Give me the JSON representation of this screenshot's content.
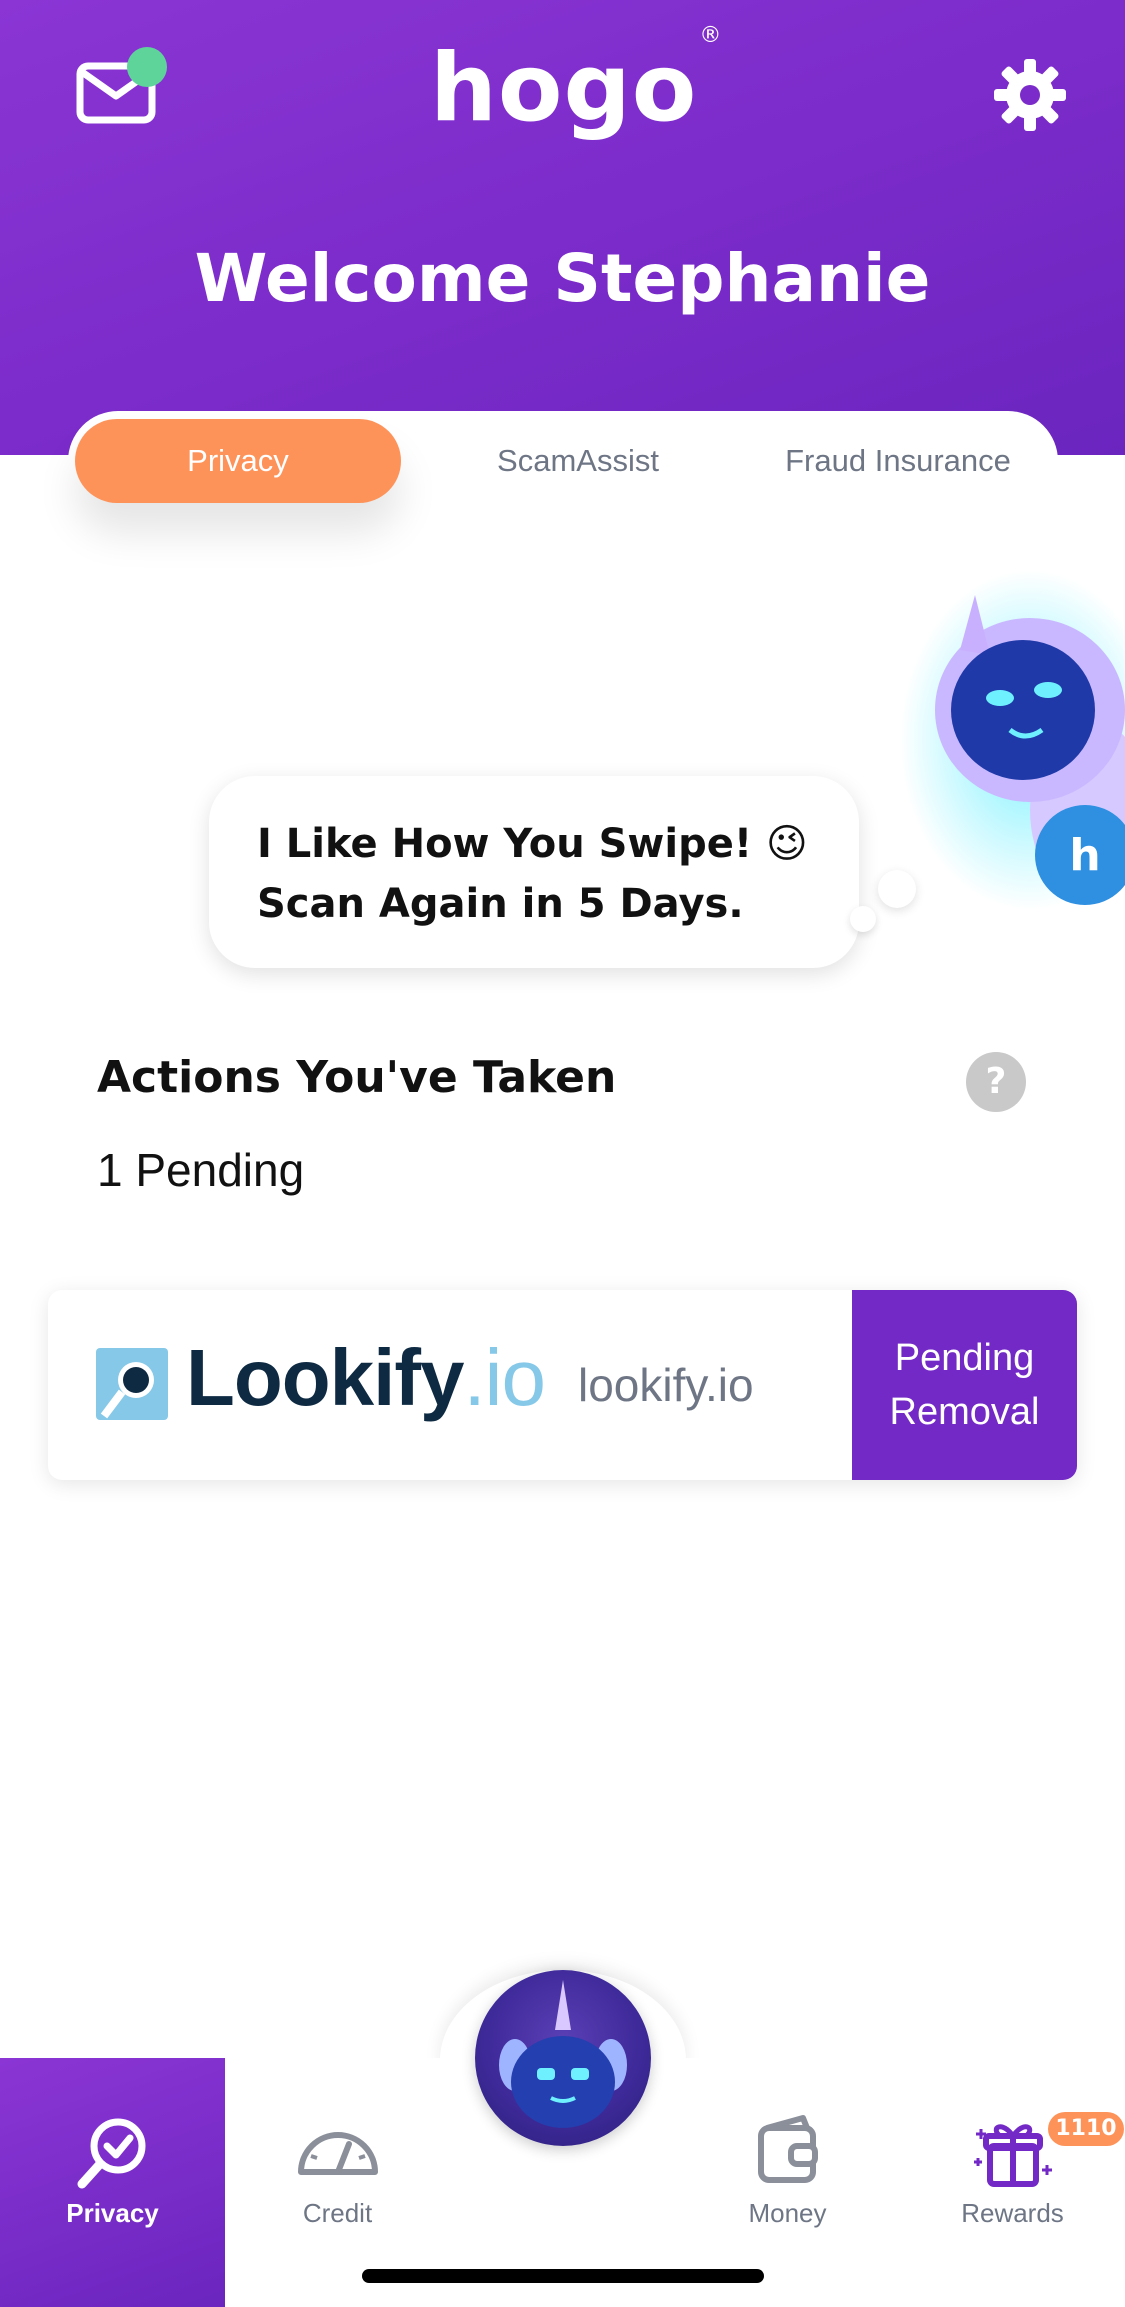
{
  "header": {
    "logo": "hogo",
    "logo_mark": "®",
    "welcome": "Welcome Stephanie",
    "mail_icon": "mail-icon",
    "settings_icon": "gear-icon",
    "notification_color": "#5ed39a"
  },
  "tabs": [
    {
      "label": "Privacy",
      "active": true
    },
    {
      "label": "ScamAssist",
      "active": false
    },
    {
      "label": "Fraud Insurance",
      "active": false
    }
  ],
  "bubble": {
    "line1": "I Like How You Swipe! 😉",
    "line2": "Scan Again in 5 Days."
  },
  "actions": {
    "title": "Actions You've Taken",
    "help_label": "?",
    "pending": "1 Pending"
  },
  "card": {
    "brand_main": "Lookify",
    "brand_suffix": ".io",
    "domain": "lookify.io",
    "status_line1": "Pending",
    "status_line2": "Removal"
  },
  "nav": {
    "items": [
      {
        "label": "Privacy",
        "icon": "privacy-check-icon",
        "active": true
      },
      {
        "label": "Credit",
        "icon": "gauge-icon",
        "active": false
      },
      {
        "label": "Money",
        "icon": "wallet-icon",
        "active": false
      },
      {
        "label": "Rewards",
        "icon": "gift-icon",
        "active": false,
        "badge": "1110"
      }
    ]
  },
  "colors": {
    "brand_purple": "#7329c6",
    "accent_orange": "#fe935a"
  }
}
